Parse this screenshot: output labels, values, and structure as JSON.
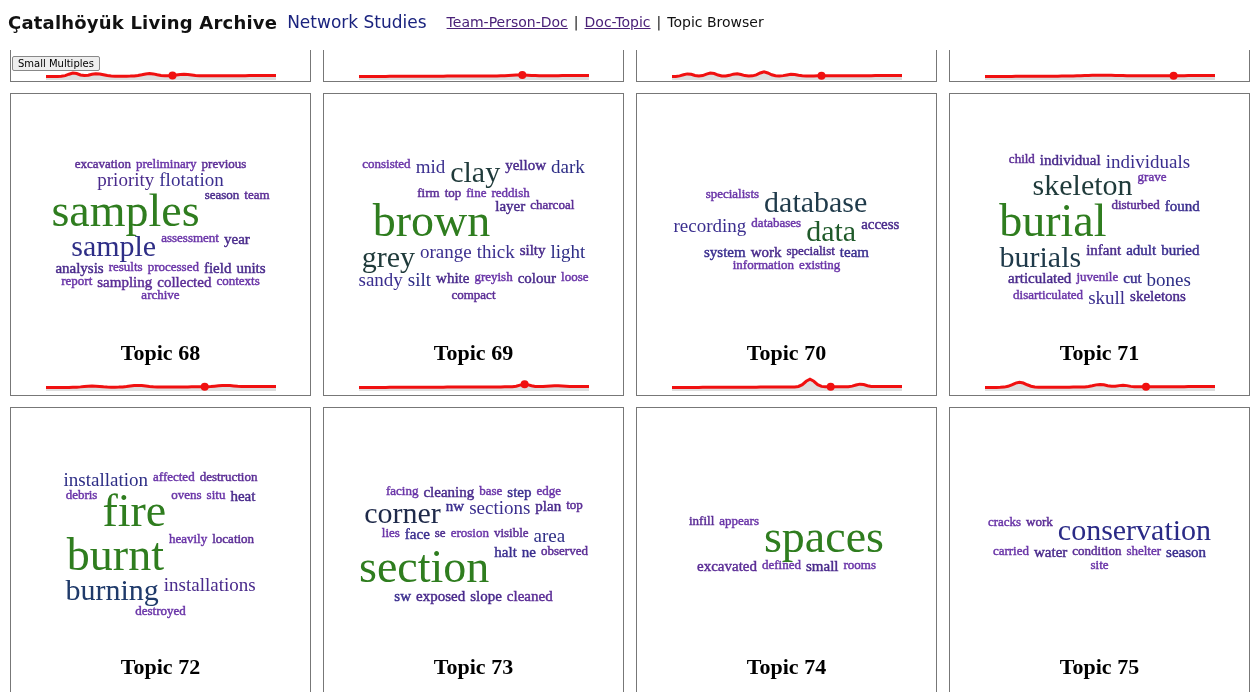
{
  "header": {
    "title": "Çatalhöyük Living Archive",
    "subtitle": "Network Studies",
    "nav": [
      {
        "text": "Team-Person-Doc",
        "kind": "link"
      },
      {
        "text": "|",
        "kind": "separator"
      },
      {
        "text": "Doc-Topic",
        "kind": "link"
      },
      {
        "text": "|",
        "kind": "separator"
      },
      {
        "text": "Topic Browser",
        "kind": "current"
      }
    ]
  },
  "small_multiples_button": "Small Multiples",
  "cards": [
    {
      "title": "Topic 68",
      "words": [
        {
          "text": "excavation",
          "kind": "xs",
          "color": "#5b2d96"
        },
        {
          "text": "preliminary",
          "kind": "xs",
          "color": "#6a35a8"
        },
        {
          "text": "previous",
          "kind": "xs",
          "color": "#5b2d96"
        },
        {
          "text": "priority",
          "kind": "m",
          "color": "#4a2b8c"
        },
        {
          "text": "flotation",
          "kind": "m",
          "color": "#3b2f8f"
        },
        {
          "text": "samples",
          "kind": "xl",
          "color": "#2f7d1f"
        },
        {
          "text": "season",
          "kind": "xs",
          "color": "#4a2b8c"
        },
        {
          "text": "team",
          "kind": "xs",
          "color": "#5b2d96"
        },
        {
          "text": "sample",
          "kind": "l",
          "color": "#2e2e86"
        },
        {
          "text": "assessment",
          "kind": "xs",
          "color": "#6a35a8"
        },
        {
          "text": "year",
          "kind": "s",
          "color": "#4a2b8c"
        },
        {
          "text": "analysis",
          "kind": "s",
          "color": "#4a2b8c"
        },
        {
          "text": "results",
          "kind": "xs",
          "color": "#6a35a8"
        },
        {
          "text": "processed",
          "kind": "xs",
          "color": "#6a35a8"
        },
        {
          "text": "field",
          "kind": "s",
          "color": "#4a2b8c"
        },
        {
          "text": "units",
          "kind": "s",
          "color": "#4a2b8c"
        },
        {
          "text": "report",
          "kind": "xs",
          "color": "#6a35a8"
        },
        {
          "text": "sampling",
          "kind": "s",
          "color": "#5b2d96"
        },
        {
          "text": "collected",
          "kind": "s",
          "color": "#5b2d96"
        },
        {
          "text": "contexts",
          "kind": "xs",
          "color": "#6a35a8"
        },
        {
          "text": "archive",
          "kind": "xs",
          "color": "#6a35a8"
        }
      ]
    },
    {
      "title": "Topic 69",
      "words": [
        {
          "text": "consisted",
          "kind": "xs",
          "color": "#6a35a8"
        },
        {
          "text": "mid",
          "kind": "m",
          "color": "#3b2f8f"
        },
        {
          "text": "clay",
          "kind": "l",
          "color": "#1f3a3a"
        },
        {
          "text": "yellow",
          "kind": "s",
          "color": "#4a2b8c"
        },
        {
          "text": "dark",
          "kind": "m",
          "color": "#2e2e86"
        },
        {
          "text": "firm",
          "kind": "xs",
          "color": "#5b2d96"
        },
        {
          "text": "top",
          "kind": "xs",
          "color": "#5b2d96"
        },
        {
          "text": "fine",
          "kind": "xs",
          "color": "#6a35a8"
        },
        {
          "text": "reddish",
          "kind": "xs",
          "color": "#6a35a8"
        },
        {
          "text": "brown",
          "kind": "xl",
          "color": "#2f7d1f"
        },
        {
          "text": "layer",
          "kind": "s",
          "color": "#4a2b8c"
        },
        {
          "text": "charcoal",
          "kind": "xs",
          "color": "#5b2d96"
        },
        {
          "text": "grey",
          "kind": "l",
          "color": "#1f3a3a"
        },
        {
          "text": "orange",
          "kind": "m",
          "color": "#3b2f8f"
        },
        {
          "text": "thick",
          "kind": "m",
          "color": "#3b2f8f"
        },
        {
          "text": "silty",
          "kind": "s",
          "color": "#4a2b8c"
        },
        {
          "text": "light",
          "kind": "m",
          "color": "#2e2e86"
        },
        {
          "text": "sandy",
          "kind": "m",
          "color": "#3b2f8f"
        },
        {
          "text": "silt",
          "kind": "m",
          "color": "#2e2e86"
        },
        {
          "text": "white",
          "kind": "s",
          "color": "#4a2b8c"
        },
        {
          "text": "greyish",
          "kind": "xs",
          "color": "#6a35a8"
        },
        {
          "text": "colour",
          "kind": "s",
          "color": "#4a2b8c"
        },
        {
          "text": "loose",
          "kind": "xs",
          "color": "#6a35a8"
        },
        {
          "text": "compact",
          "kind": "xs",
          "color": "#5b2d96"
        }
      ]
    },
    {
      "title": "Topic 70",
      "words": [
        {
          "text": "specialists",
          "kind": "xs",
          "color": "#6a35a8"
        },
        {
          "text": "database",
          "kind": "l",
          "color": "#1f3a4a"
        },
        {
          "text": "recording",
          "kind": "m",
          "color": "#3b2f8f"
        },
        {
          "text": "databases",
          "kind": "xs",
          "color": "#6a35a8"
        },
        {
          "text": "data",
          "kind": "l",
          "color": "#1f5a2a"
        },
        {
          "text": "access",
          "kind": "s",
          "color": "#4a2b8c"
        },
        {
          "text": "system",
          "kind": "s",
          "color": "#3b2f8f"
        },
        {
          "text": "work",
          "kind": "s",
          "color": "#4a2b8c"
        },
        {
          "text": "specialist",
          "kind": "xs",
          "color": "#4a2b8c"
        },
        {
          "text": "team",
          "kind": "s",
          "color": "#3b2f8f"
        },
        {
          "text": "information",
          "kind": "xs",
          "color": "#6a35a8"
        },
        {
          "text": "existing",
          "kind": "xs",
          "color": "#6a35a8"
        }
      ]
    },
    {
      "title": "Topic 71",
      "words": [
        {
          "text": "child",
          "kind": "xs",
          "color": "#5b2d96"
        },
        {
          "text": "individual",
          "kind": "s",
          "color": "#4a2b8c"
        },
        {
          "text": "individuals",
          "kind": "m",
          "color": "#3b2f8f"
        },
        {
          "text": "skeleton",
          "kind": "l",
          "color": "#1f3a3a"
        },
        {
          "text": "grave",
          "kind": "xs",
          "color": "#6a35a8"
        },
        {
          "text": "burial",
          "kind": "xl",
          "color": "#2f7d1f"
        },
        {
          "text": "disturbed",
          "kind": "xs",
          "color": "#5b2d96"
        },
        {
          "text": "found",
          "kind": "s",
          "color": "#3b2f8f"
        },
        {
          "text": "burials",
          "kind": "l",
          "color": "#1f3a4a"
        },
        {
          "text": "infant",
          "kind": "s",
          "color": "#4a2b8c"
        },
        {
          "text": "adult",
          "kind": "s",
          "color": "#3b2f8f"
        },
        {
          "text": "buried",
          "kind": "s",
          "color": "#3b2f8f"
        },
        {
          "text": "articulated",
          "kind": "s",
          "color": "#4a2b8c"
        },
        {
          "text": "juvenile",
          "kind": "xs",
          "color": "#6a35a8"
        },
        {
          "text": "cut",
          "kind": "s",
          "color": "#3b2f8f"
        },
        {
          "text": "bones",
          "kind": "m",
          "color": "#2e2e86"
        },
        {
          "text": "disarticulated",
          "kind": "xs",
          "color": "#6a35a8"
        },
        {
          "text": "skull",
          "kind": "m",
          "color": "#3b2f8f"
        },
        {
          "text": "skeletons",
          "kind": "s",
          "color": "#4a2b8c"
        }
      ]
    },
    {
      "title": "Topic 72",
      "words": [
        {
          "text": "installation",
          "kind": "m",
          "color": "#2e2e86"
        },
        {
          "text": "affected",
          "kind": "xs",
          "color": "#6a35a8"
        },
        {
          "text": "destruction",
          "kind": "xs",
          "color": "#5b2d96"
        },
        {
          "text": "debris",
          "kind": "xs",
          "color": "#6a35a8"
        },
        {
          "text": "fire",
          "kind": "xl",
          "color": "#2f7d1f"
        },
        {
          "text": "ovens",
          "kind": "xs",
          "color": "#6a35a8"
        },
        {
          "text": "situ",
          "kind": "xs",
          "color": "#6a35a8"
        },
        {
          "text": "heat",
          "kind": "s",
          "color": "#4a2b8c"
        },
        {
          "text": "burnt",
          "kind": "xl",
          "color": "#2f7d1f"
        },
        {
          "text": "heavily",
          "kind": "xs",
          "color": "#6a35a8"
        },
        {
          "text": "location",
          "kind": "xs",
          "color": "#5b2d96"
        },
        {
          "text": "burning",
          "kind": "l",
          "color": "#1f3a6a"
        },
        {
          "text": "installations",
          "kind": "m",
          "color": "#4a2b8c"
        },
        {
          "text": "destroyed",
          "kind": "xs",
          "color": "#6a35a8"
        }
      ]
    },
    {
      "title": "Topic 73",
      "words": [
        {
          "text": "facing",
          "kind": "xs",
          "color": "#6a35a8"
        },
        {
          "text": "cleaning",
          "kind": "s",
          "color": "#4a2b8c"
        },
        {
          "text": "base",
          "kind": "xs",
          "color": "#6a35a8"
        },
        {
          "text": "step",
          "kind": "s",
          "color": "#3b2f8f"
        },
        {
          "text": "edge",
          "kind": "xs",
          "color": "#6a35a8"
        },
        {
          "text": "corner",
          "kind": "l",
          "color": "#1f2a4a"
        },
        {
          "text": "nw",
          "kind": "s",
          "color": "#3b2f8f"
        },
        {
          "text": "sections",
          "kind": "m",
          "color": "#3b2f8f"
        },
        {
          "text": "plan",
          "kind": "s",
          "color": "#4a2b8c"
        },
        {
          "text": "top",
          "kind": "xs",
          "color": "#5b2d96"
        },
        {
          "text": "lies",
          "kind": "xs",
          "color": "#6a35a8"
        },
        {
          "text": "face",
          "kind": "s",
          "color": "#3b2f8f"
        },
        {
          "text": "se",
          "kind": "xs",
          "color": "#4a2b8c"
        },
        {
          "text": "erosion",
          "kind": "xs",
          "color": "#6a35a8"
        },
        {
          "text": "visible",
          "kind": "xs",
          "color": "#5b2d96"
        },
        {
          "text": "area",
          "kind": "m",
          "color": "#2e2e86"
        },
        {
          "text": "section",
          "kind": "xl",
          "color": "#2f7d1f"
        },
        {
          "text": "halt",
          "kind": "s",
          "color": "#3b2f8f"
        },
        {
          "text": "ne",
          "kind": "s",
          "color": "#3b2f8f"
        },
        {
          "text": "observed",
          "kind": "xs",
          "color": "#5b2d96"
        },
        {
          "text": "sw",
          "kind": "s",
          "color": "#3b2f8f"
        },
        {
          "text": "exposed",
          "kind": "s",
          "color": "#4a2b8c"
        },
        {
          "text": "slope",
          "kind": "s",
          "color": "#4a2b8c"
        },
        {
          "text": "cleaned",
          "kind": "s",
          "color": "#5b2d96"
        }
      ]
    },
    {
      "title": "Topic 74",
      "words": [
        {
          "text": "infill",
          "kind": "xs",
          "color": "#5b2d96"
        },
        {
          "text": "appears",
          "kind": "xs",
          "color": "#6a35a8"
        },
        {
          "text": "spaces",
          "kind": "xl",
          "color": "#2f7d1f"
        },
        {
          "text": "excavated",
          "kind": "s",
          "color": "#5b2d96"
        },
        {
          "text": "defined",
          "kind": "xs",
          "color": "#6a35a8"
        },
        {
          "text": "small",
          "kind": "s",
          "color": "#4a2b8c"
        },
        {
          "text": "rooms",
          "kind": "xs",
          "color": "#6a35a8"
        }
      ]
    },
    {
      "title": "Topic 75",
      "words": [
        {
          "text": "cracks",
          "kind": "xs",
          "color": "#6a35a8"
        },
        {
          "text": "work",
          "kind": "xs",
          "color": "#5b2d96"
        },
        {
          "text": "conservation",
          "kind": "l",
          "color": "#2a2a86"
        },
        {
          "text": "carried",
          "kind": "xs",
          "color": "#6a35a8"
        },
        {
          "text": "water",
          "kind": "s",
          "color": "#4a2b8c"
        },
        {
          "text": "condition",
          "kind": "xs",
          "color": "#5b2d96"
        },
        {
          "text": "shelter",
          "kind": "xs",
          "color": "#6a35a8"
        },
        {
          "text": "season",
          "kind": "s",
          "color": "#3b2f8f"
        },
        {
          "text": "site",
          "kind": "xs",
          "color": "#6a35a8"
        }
      ]
    }
  ]
}
